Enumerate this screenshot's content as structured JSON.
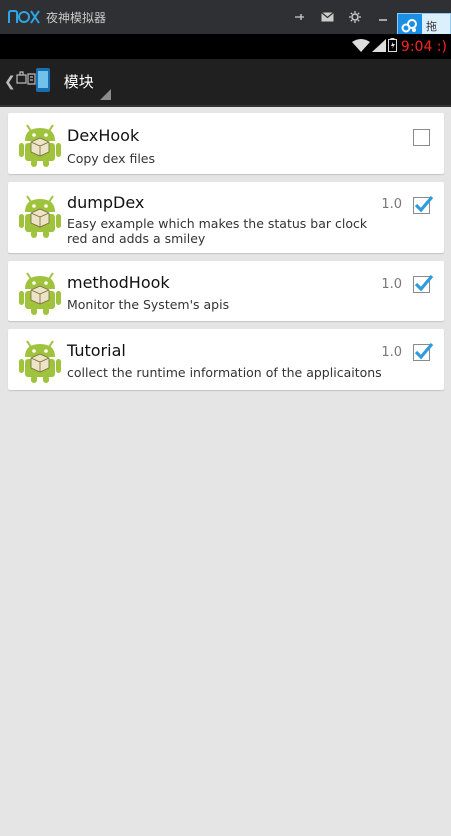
{
  "emulator": {
    "logo_text": "nox",
    "title": "夜神模拟器",
    "float_label": "拖"
  },
  "status_bar": {
    "clock": "9:04 :)"
  },
  "action_bar": {
    "title": "模块"
  },
  "modules": [
    {
      "name": "DexHook",
      "description": "Copy dex files",
      "version": "",
      "enabled": false
    },
    {
      "name": "dumpDex",
      "description": "Easy example which makes the status bar clock red and adds a smiley",
      "version": "1.0",
      "enabled": true
    },
    {
      "name": "methodHook",
      "description": "Monitor the System's apis",
      "version": "1.0",
      "enabled": true
    },
    {
      "name": "Tutorial",
      "description": "collect the runtime information of the applicaitons",
      "version": "1.0",
      "enabled": true
    }
  ],
  "colors": {
    "clock": "#ff2020",
    "check": "#2f9ce0",
    "android_green": "#9fc33c",
    "background": "#e5e5e5"
  }
}
